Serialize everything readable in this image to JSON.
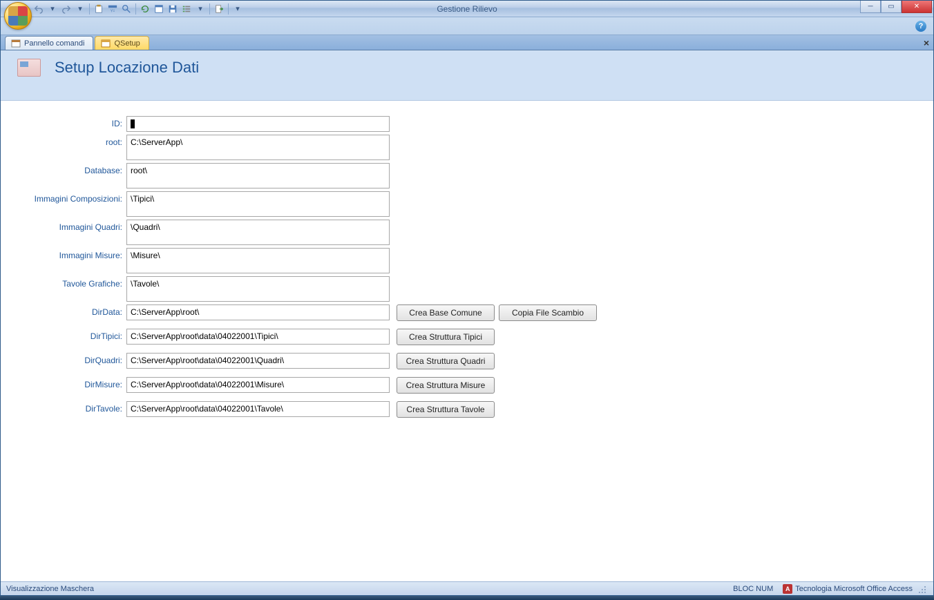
{
  "window": {
    "title": "Gestione Rilievo"
  },
  "tabs": [
    {
      "label": "Pannello comandi",
      "active": false
    },
    {
      "label": "QSetup",
      "active": true
    }
  ],
  "form": {
    "title": "Setup Locazione Dati",
    "fields": {
      "id": {
        "label": "ID:",
        "value": ""
      },
      "root": {
        "label": "root:",
        "value": "C:\\ServerApp\\"
      },
      "database": {
        "label": "Database:",
        "value": "root\\"
      },
      "immaginiComposizioni": {
        "label": "Immagini Composizioni:",
        "value": "\\Tipici\\"
      },
      "immaginiQuadri": {
        "label": "Immagini Quadri:",
        "value": "\\Quadri\\"
      },
      "immaginiMisure": {
        "label": "Immagini Misure:",
        "value": "\\Misure\\"
      },
      "tavoleGrafiche": {
        "label": "Tavole Grafiche:",
        "value": "\\Tavole\\"
      },
      "dirData": {
        "label": "DirData:",
        "value": "C:\\ServerApp\\root\\"
      },
      "dirTipici": {
        "label": "DirTipici:",
        "value": "C:\\ServerApp\\root\\data\\04022001\\Tipici\\"
      },
      "dirQuadri": {
        "label": "DirQuadri:",
        "value": "C:\\ServerApp\\root\\data\\04022001\\Quadri\\"
      },
      "dirMisure": {
        "label": "DirMisure:",
        "value": "C:\\ServerApp\\root\\data\\04022001\\Misure\\"
      },
      "dirTavole": {
        "label": "DirTavole:",
        "value": "C:\\ServerApp\\root\\data\\04022001\\Tavole\\"
      }
    }
  },
  "buttons": {
    "creaBaseComune": "Crea Base Comune",
    "copiaFileScambio": "Copia File Scambio",
    "creaStrutturaTipici": "Crea Struttura Tipici",
    "creaStrutturaQuadri": "Crea Struttura Quadri",
    "creaStrutturaMisure": "Crea Struttura Misure",
    "creaStrutturaTavole": "Crea Struttura Tavole"
  },
  "statusbar": {
    "left": "Visualizzazione Maschera",
    "blocNum": "BLOC NUM",
    "tech": "Tecnologia Microsoft Office Access"
  }
}
